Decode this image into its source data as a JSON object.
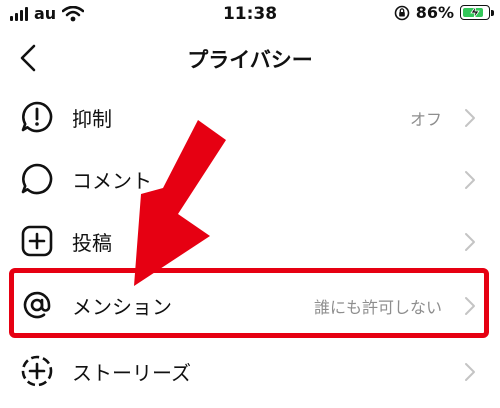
{
  "status_bar": {
    "carrier": "au",
    "time": "11:38",
    "battery_percent": "86%",
    "battery_level": 0.86,
    "icons": [
      "signal-icon",
      "wifi-icon",
      "orientation-lock-icon",
      "battery-charging-icon"
    ]
  },
  "nav": {
    "title": "プライバシー",
    "back_icon": "chevron-left-icon"
  },
  "rows": [
    {
      "label": "抑制",
      "value": "オフ",
      "icon": "exclamation-bubble-icon"
    },
    {
      "label": "コメント",
      "value": "",
      "icon": "comment-bubble-icon"
    },
    {
      "label": "投稿",
      "value": "",
      "icon": "plus-square-icon"
    },
    {
      "label": "メンション",
      "value": "誰にも許可しない",
      "icon": "at-sign-icon"
    },
    {
      "label": "ストーリーズ",
      "value": "",
      "icon": "story-plus-icon"
    }
  ],
  "annotation": {
    "highlight_color": "#e60012",
    "arrow_color": "#e60012"
  },
  "colors": {
    "battery_fill": "#33c759",
    "secondary_text": "#8e8e8e"
  }
}
